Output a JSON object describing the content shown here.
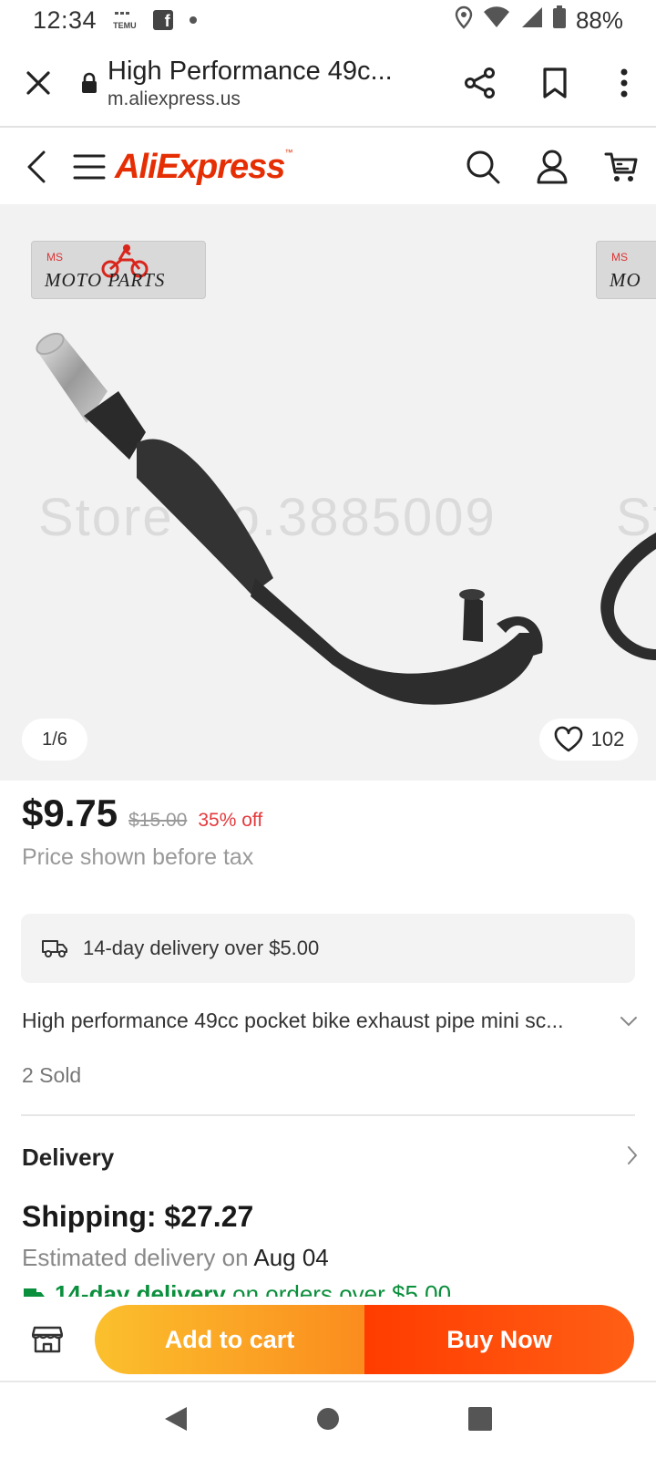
{
  "status_bar": {
    "time": "12:34",
    "temu_label": "TEMU",
    "battery": "88%",
    "icons": [
      "temu-icon",
      "facebook-icon",
      "notification-dot-icon",
      "location-icon",
      "wifi-icon",
      "signal-icon",
      "battery-icon"
    ]
  },
  "browser": {
    "title": "High Performance 49c...",
    "url": "m.aliexpress.us"
  },
  "site_header": {
    "logo": "AliExpress",
    "logo_mark": "™"
  },
  "gallery": {
    "badge_small": "MS",
    "badge_name": "MOTO PARTS",
    "watermark": "Store No.3885009",
    "counter": "1/6",
    "wishlist_count": "102",
    "next_badge_small": "MS",
    "next_badge_name": "MO",
    "next_watermark": "St"
  },
  "price": {
    "current": "$9.75",
    "original": "$15.00",
    "discount": "35% off",
    "tax_note": "Price shown before tax"
  },
  "delivery_banner": "14-day delivery over $5.00",
  "product": {
    "title": "High performance 49cc pocket bike exhaust pipe mini sc...",
    "sold": "2 Sold"
  },
  "delivery": {
    "label": "Delivery",
    "shipping": "Shipping: $27.27",
    "est_prefix": "Estimated delivery on ",
    "est_date": "Aug 04",
    "promo_bold": "14-day delivery",
    "promo_rest": "on orders over $5.00"
  },
  "actions": {
    "add_to_cart": "Add to cart",
    "buy_now": "Buy Now"
  },
  "colors": {
    "brand": "#e62e04",
    "discount": "#e4393c",
    "cart_gradient": [
      "#fbc02d",
      "#fb8c1e"
    ],
    "buy_gradient": [
      "#ff3c00",
      "#ff5f15"
    ],
    "promo_green": "#0a8f3c"
  }
}
